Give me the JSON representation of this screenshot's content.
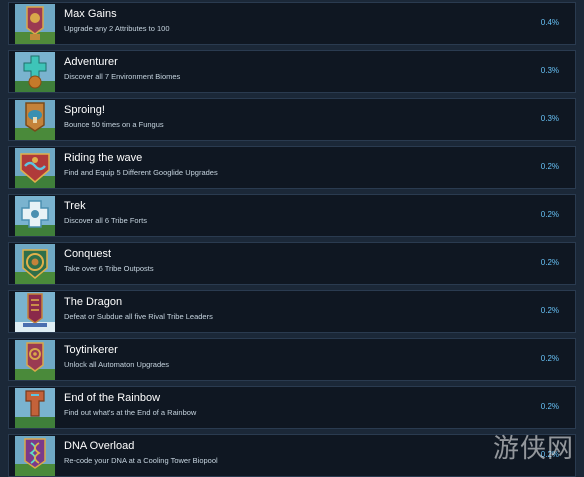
{
  "achievements": [
    {
      "title": "Max Gains",
      "description": "Upgrade any 2 Attributes to 100",
      "percent": "0.4%",
      "icon": "banner-emblem-icon"
    },
    {
      "title": "Adventurer",
      "description": "Discover all 7 Environment Biomes",
      "percent": "0.3%",
      "icon": "cross-medal-icon"
    },
    {
      "title": "Sproing!",
      "description": "Bounce 50 times on a Fungus",
      "percent": "0.3%",
      "icon": "mushroom-banner-icon"
    },
    {
      "title": "Riding the wave",
      "description": "Find and Equip 5 Different Googlide Upgrades",
      "percent": "0.2%",
      "icon": "wave-shield-icon"
    },
    {
      "title": "Trek",
      "description": "Discover all 6 Tribe Forts",
      "percent": "0.2%",
      "icon": "fort-badge-icon"
    },
    {
      "title": "Conquest",
      "description": "Take over 6 Tribe Outposts",
      "percent": "0.2%",
      "icon": "wreath-shield-icon"
    },
    {
      "title": "The Dragon",
      "description": "Defeat or Subdue all five Rival Tribe Leaders",
      "percent": "0.2%",
      "icon": "dragon-banner-icon"
    },
    {
      "title": "Toytinkerer",
      "description": "Unlock all Automaton Upgrades",
      "percent": "0.2%",
      "icon": "gear-banner-icon"
    },
    {
      "title": "End of the Rainbow",
      "description": "Find out what's at the End of a Rainbow",
      "percent": "0.2%",
      "icon": "rainbow-banner-icon"
    },
    {
      "title": "DNA Overload",
      "description": "Re-code your DNA at a Cooling Tower Biopool",
      "percent": "0.2%",
      "icon": "dna-banner-icon"
    }
  ],
  "watermark": "游侠网",
  "colors": {
    "background": "#1b2838",
    "row": "#0f1722",
    "border": "#2a3b50",
    "percent": "#67c1f5"
  }
}
